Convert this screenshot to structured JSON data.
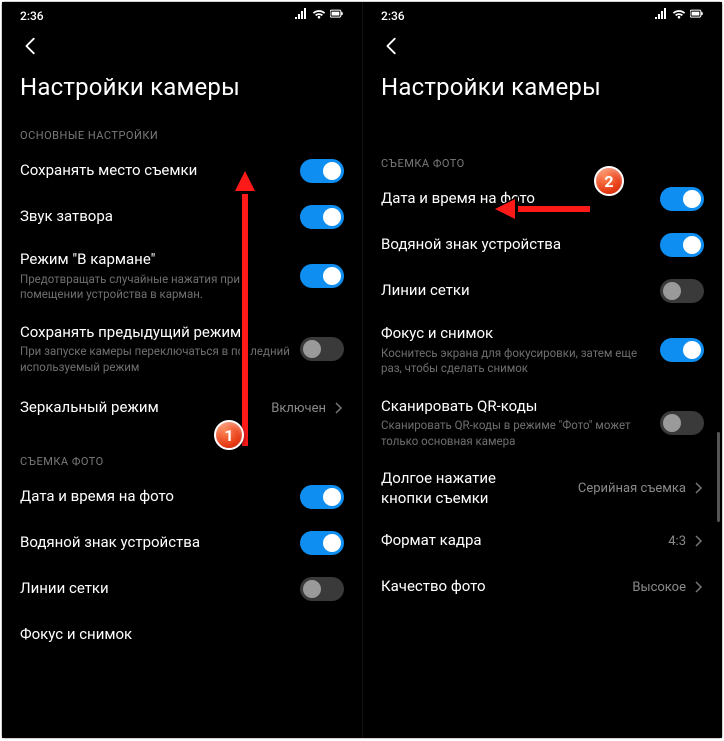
{
  "status": {
    "time": "2:36"
  },
  "left": {
    "title": "Настройки камеры",
    "section1": "ОСНОВНЫЕ НАСТРОЙКИ",
    "r_loc": "Сохранять место съемки",
    "r_shutter": "Звук затвора",
    "r_pocket": "Режим \"В кармане\"",
    "r_pocket_sub": "Предотвращать случайные нажатия при помещении устройства в карман.",
    "r_prev": "Сохранять предыдущий режим",
    "r_prev_sub": "При запуске камеры переключаться в последний используемый режим",
    "r_mirror": "Зеркальный режим",
    "r_mirror_val": "Включен",
    "section2": "СЪЕМКА ФОТО",
    "r_date": "Дата и время на фото",
    "r_water": "Водяной знак устройства",
    "r_grid": "Линии сетки",
    "r_focus": "Фокус и снимок"
  },
  "right": {
    "title": "Настройки камеры",
    "section": "СЪЕМКА ФОТО",
    "r_date": "Дата и время на фото",
    "r_water": "Водяной знак устройства",
    "r_grid": "Линии сетки",
    "r_focus": "Фокус и снимок",
    "r_focus_sub": "Коснитесь экрана для фокусировки, затем еще раз, чтобы сделать снимок",
    "r_qr": "Сканировать QR-коды",
    "r_qr_sub": "Сканировать QR-коды в режиме \"Фото\" может только основная камера",
    "r_long": "Долгое нажатие кнопки съемки",
    "r_long_val": "Серийная съемка",
    "r_aspect": "Формат кадра",
    "r_aspect_val": "4:3",
    "r_quality": "Качество фото",
    "r_quality_val": "Высокое"
  },
  "badges": {
    "b1": "1",
    "b2": "2"
  },
  "colors": {
    "accent": "#0e8ef0",
    "badge": "#e63a14"
  }
}
